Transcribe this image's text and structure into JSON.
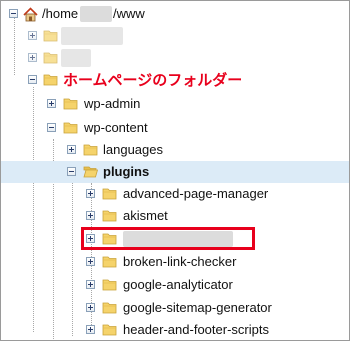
{
  "tree": {
    "root": {
      "prefix": "/home",
      "suffix": "/www"
    },
    "annotation": "ホームページのフォルダー",
    "folders": {
      "wp_admin": "wp-admin",
      "wp_content": "wp-content",
      "languages": "languages",
      "plugins": "plugins",
      "advanced_page_manager": "advanced-page-manager",
      "akismet": "akismet",
      "broken_link_checker": "broken-link-checker",
      "google_analyticator": "google-analyticator",
      "google_sitemap_generator": "google-sitemap-generator",
      "header_and_footer_scripts": "header-and-footer-scripts"
    }
  },
  "colors": {
    "annotation": "#e8001c",
    "selection": "#dcebf7",
    "folder": "#f5d36b"
  },
  "icons": {
    "expand": "plus-box-icon",
    "collapse": "minus-box-icon",
    "folder": "folder-icon",
    "home": "home-icon"
  }
}
